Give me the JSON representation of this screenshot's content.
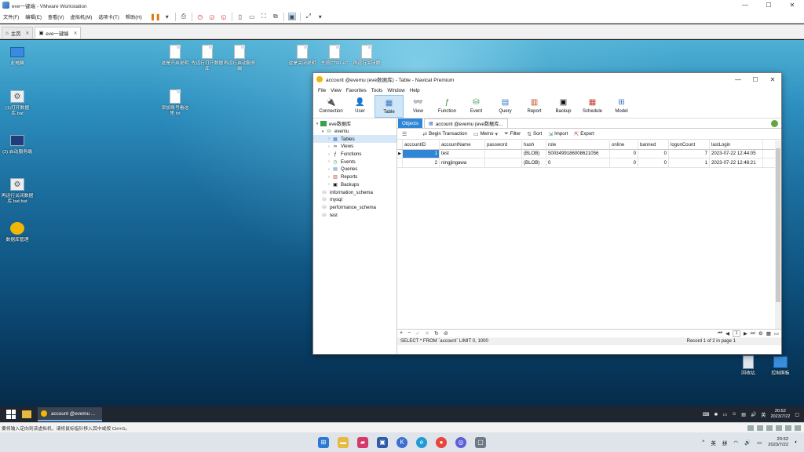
{
  "vm": {
    "title": "eve一键端 - VMware Workstation",
    "menu": [
      "文件(F)",
      "编辑(E)",
      "查看(V)",
      "虚拟机(M)",
      "选项卡(T)",
      "帮助(H)"
    ],
    "tabs": [
      {
        "label": "主页"
      },
      {
        "label": "eve一键端"
      }
    ],
    "status_text": "要将输入定向到该虚拟机，请将鼠标指针移入其中或按 Ctrl+G。"
  },
  "desktop": {
    "icons": [
      {
        "label": "此电脑"
      },
      {
        "label": "(1)打开数据库.bat"
      },
      {
        "label": "(2) 启动服务端"
      },
      {
        "label": "再运行关闭数据库.bat.bat"
      },
      {
        "label": "数据库管理"
      },
      {
        "label": "这是开启说明"
      },
      {
        "label": "先运行打开数据库"
      },
      {
        "label": "再运行启动服务端"
      },
      {
        "label": "添加账号看这里.txt"
      },
      {
        "label": "这是关闭说明"
      },
      {
        "label": "先按CTRL+C"
      },
      {
        "label": "再运行关闭数"
      },
      {
        "label": "回收站"
      },
      {
        "label": "控制面板"
      }
    ]
  },
  "navicat": {
    "title": "account @evemu (eve数据库) - Table - Navicat Premium",
    "menu": [
      "File",
      "View",
      "Favorites",
      "Tools",
      "Window",
      "Help"
    ],
    "toolbar": [
      {
        "label": "Connection"
      },
      {
        "label": "User"
      },
      {
        "label": "Table"
      },
      {
        "label": "View"
      },
      {
        "label": "Function"
      },
      {
        "label": "Event"
      },
      {
        "label": "Query"
      },
      {
        "label": "Report"
      },
      {
        "label": "Backup"
      },
      {
        "label": "Schedule"
      },
      {
        "label": "Model"
      }
    ],
    "tree": [
      {
        "label": "eve数据库"
      },
      {
        "label": "evemu"
      },
      {
        "label": "Tables"
      },
      {
        "label": "Views"
      },
      {
        "label": "Functions"
      },
      {
        "label": "Events"
      },
      {
        "label": "Queries"
      },
      {
        "label": "Reports"
      },
      {
        "label": "Backups"
      },
      {
        "label": "information_schema"
      },
      {
        "label": "mysql"
      },
      {
        "label": "performance_schema"
      },
      {
        "label": "test"
      }
    ],
    "tabs": {
      "objects": "Objects",
      "table": "account @evemu (eve数据库..."
    },
    "table_toolbar": {
      "begin_transaction": "Begin Transaction",
      "memo": "Memo",
      "filter": "Filter",
      "sort": "Sort",
      "import": "Import",
      "export": "Export"
    },
    "grid": {
      "columns": [
        "accountID",
        "accountName",
        "password",
        "hash",
        "role",
        "online",
        "banned",
        "logonCount",
        "lastLogin"
      ],
      "rows": [
        [
          "1",
          "test",
          "",
          "(BLOB)",
          "5003499186008621056",
          "0",
          "0",
          "7",
          "2023-07-22 12:44:05"
        ],
        [
          "2",
          "ningjingawa",
          "",
          "(BLOB)",
          "0",
          "0",
          "0",
          "1",
          "2023-07-22 12:48:21"
        ]
      ]
    },
    "pager": {
      "page": "1"
    },
    "status": {
      "sql": "SELECT * FROM `account` LIMIT 0, 1000",
      "record": "Record 1 of 2 in page 1"
    }
  },
  "guest_taskbar": {
    "app_label": "account @evemu ...",
    "ime": "英",
    "time": "20:52",
    "date": "2023/7/22"
  },
  "host_taskbar": {
    "ime1": "英",
    "ime2": "拼",
    "time": "20:52",
    "date": "2023/7/22"
  }
}
